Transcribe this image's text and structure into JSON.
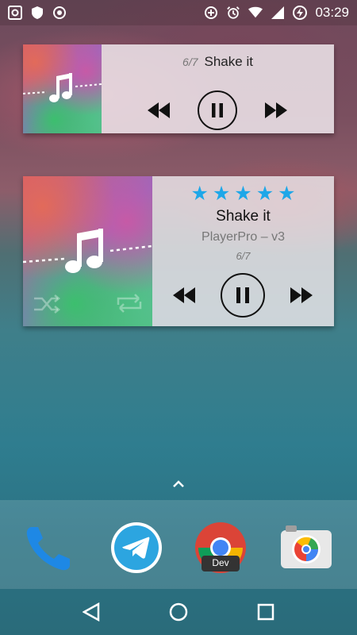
{
  "status_bar": {
    "time": "03:29",
    "left_icons": [
      "screenshot-icon",
      "shield-icon",
      "record-icon"
    ],
    "right_icons": [
      "data-saver-icon",
      "alarm-icon",
      "wifi-icon",
      "signal-icon",
      "battery-charging-icon"
    ]
  },
  "widget_small": {
    "track_index": "6/7",
    "track_title": "Shake it",
    "is_playing": true
  },
  "widget_large": {
    "rating_stars": 5,
    "track_title": "Shake it",
    "album": "PlayerPro – v3",
    "track_index": "6/7",
    "is_playing": true
  },
  "dock": {
    "apps": [
      {
        "name": "Phone"
      },
      {
        "name": "Telegram"
      },
      {
        "name": "Chrome Dev",
        "badge": "Dev"
      },
      {
        "name": "Camera"
      }
    ]
  },
  "colors": {
    "accent_star": "#1ea7e8",
    "telegram": "#2ca5e0",
    "phone": "#1e88e5"
  }
}
